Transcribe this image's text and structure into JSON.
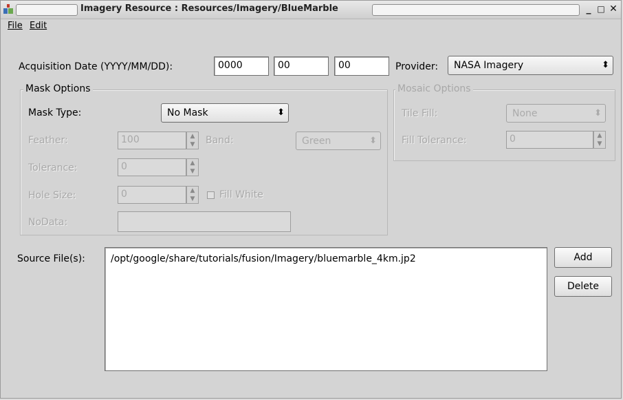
{
  "window": {
    "title": "Imagery Resource : Resources/Imagery/BlueMarble",
    "controls": {
      "minimize": "_",
      "maximize": "□",
      "close": "✕"
    }
  },
  "menubar": {
    "file": "File",
    "edit": "Edit"
  },
  "acquisition": {
    "label": "Acquisition Date (YYYY/MM/DD):",
    "year": "0000",
    "month": "00",
    "day": "00"
  },
  "provider": {
    "label": "Provider:",
    "value": "NASA Imagery"
  },
  "mask_options": {
    "title": "Mask Options",
    "mask_type_label": "Mask Type:",
    "mask_type_value": "No Mask",
    "feather_label": "Feather:",
    "feather_value": "100",
    "band_label": "Band:",
    "band_value": "Green",
    "tolerance_label": "Tolerance:",
    "tolerance_value": "0",
    "hole_size_label": "Hole Size:",
    "hole_size_value": "0",
    "fill_white_label": "Fill White",
    "nodata_label": "NoData:",
    "nodata_value": ""
  },
  "mosaic_options": {
    "title": "Mosaic Options",
    "tile_fill_label": "Tile Fill:",
    "tile_fill_value": "None",
    "fill_tolerance_label": "Fill Tolerance:",
    "fill_tolerance_value": "0"
  },
  "sources": {
    "label": "Source File(s):",
    "files": [
      "/opt/google/share/tutorials/fusion/Imagery/bluemarble_4km.jp2"
    ],
    "add_label": "Add",
    "delete_label": "Delete"
  },
  "icons": [
    "app-icon",
    "minimize-icon",
    "maximize-icon",
    "close-icon",
    "dropdown-arrow-icon",
    "spin-up-icon",
    "spin-down-icon",
    "checkbox-icon"
  ]
}
